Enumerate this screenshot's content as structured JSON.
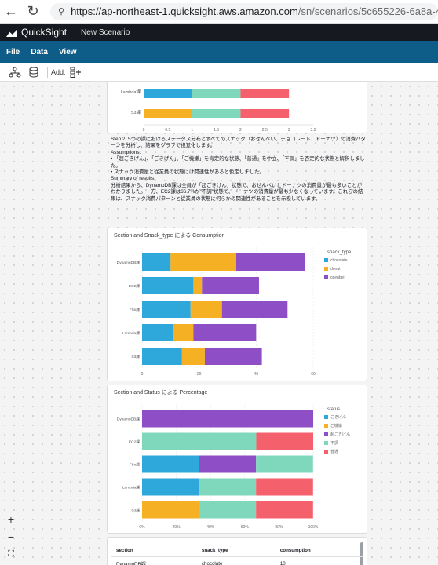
{
  "browser": {
    "url_host": "https://ap-northeast-1.quicksight.aws.amazon.com",
    "url_rest": "/sn/scenarios/5c655226-6a8a-4388-af71"
  },
  "app": {
    "name": "QuickSight",
    "scenario": "New Scenario"
  },
  "menu": [
    "File",
    "Data",
    "View"
  ],
  "toolbar": {
    "add_label": "Add:"
  },
  "top_chart": {
    "categories": [
      "Lambda課",
      "S3課"
    ],
    "ticks": [
      "0",
      "0.5",
      "1",
      "1.5",
      "2",
      "2.5",
      "3",
      "3.5"
    ],
    "colors": [
      "#2ea8db",
      "#7fd8bb",
      "#f4606c",
      "#f5b123"
    ]
  },
  "text": {
    "step": "Step 2: 5つの課におけるステータス分布とすべてのスナック（おせんべい、チョコレート、ドーナツ）の消費パターンを分析し、結果をグラフで視覚化します。",
    "assumptions_title": "Assumptions:",
    "assumption1": "• 「超ごきげん」、「ごきげん」、「ご機嫌」を肯定的な状態、「普通」を中立、「不調」を否定的な状態と解釈しました。",
    "assumption2": "• スナック消費量と従業員の状態には関連性があると仮定しました。",
    "summary_title": "Summary of results:",
    "summary": "分析結果から、DynamoDB課は全員が「超ごきげん」状態で、おせんべいとドーナツの消費量が最も多いことがわかりました。一方、EC2課は66.7%が\"不調\"状態で、ドーナツの消費量が最も少なくなっています。これらの結果は、スナック消費パターンと従業員の状態に何らかの関連性があることを示唆しています。"
  },
  "chart_data": [
    {
      "type": "bar",
      "orientation": "horizontal",
      "stacked": true,
      "title": "Section and Snack_type による Consumption",
      "categories": [
        "DynamoDB課",
        "EC2課",
        "FSx課",
        "Lambda課",
        "S3課"
      ],
      "legend_title": "snack_type",
      "legend_position": "right",
      "xlim": [
        0,
        60
      ],
      "ticks": [
        "0",
        "20",
        "40",
        "60"
      ],
      "series": [
        {
          "name": "chocolate",
          "color": "#2ea8db",
          "values": [
            10,
            18,
            17,
            11,
            14
          ]
        },
        {
          "name": "donut",
          "color": "#f5b123",
          "values": [
            23,
            3,
            11,
            7,
            8
          ]
        },
        {
          "name": "osenbei",
          "color": "#8e4ec6",
          "values": [
            24,
            20,
            23,
            22,
            20
          ]
        }
      ]
    },
    {
      "type": "bar",
      "orientation": "horizontal",
      "stacked": true,
      "title": "Section and Status による Percentage",
      "categories": [
        "DynamoDB課",
        "EC2課",
        "FSx課",
        "Lambda課",
        "S3課"
      ],
      "legend_title": "status",
      "legend_position": "right",
      "xlim": [
        0,
        100
      ],
      "ticks": [
        "0%",
        "20%",
        "40%",
        "60%",
        "80%",
        "100%"
      ],
      "series": [
        {
          "name": "ごきげん",
          "color": "#2ea8db",
          "values": [
            0,
            0,
            33.3,
            33.3,
            0
          ]
        },
        {
          "name": "ご機嫌",
          "color": "#f5b123",
          "values": [
            0,
            0,
            0,
            0,
            33.3
          ]
        },
        {
          "name": "超ごきげん",
          "color": "#8e4ec6",
          "values": [
            100,
            0,
            33.3,
            0,
            0
          ]
        },
        {
          "name": "不調",
          "color": "#7fd8bb",
          "values": [
            0,
            66.7,
            33.3,
            33.3,
            33.3
          ]
        },
        {
          "name": "普通",
          "color": "#f4606c",
          "values": [
            0,
            33.3,
            0,
            33.3,
            33.3
          ]
        }
      ]
    }
  ],
  "table": {
    "headers": [
      "section",
      "snack_type",
      "consumption"
    ],
    "rows": [
      [
        "DynamoDB課",
        "chocolate",
        "10"
      ]
    ]
  },
  "zoom": {
    "in": "+",
    "out": "−",
    "fit": "⛶"
  }
}
